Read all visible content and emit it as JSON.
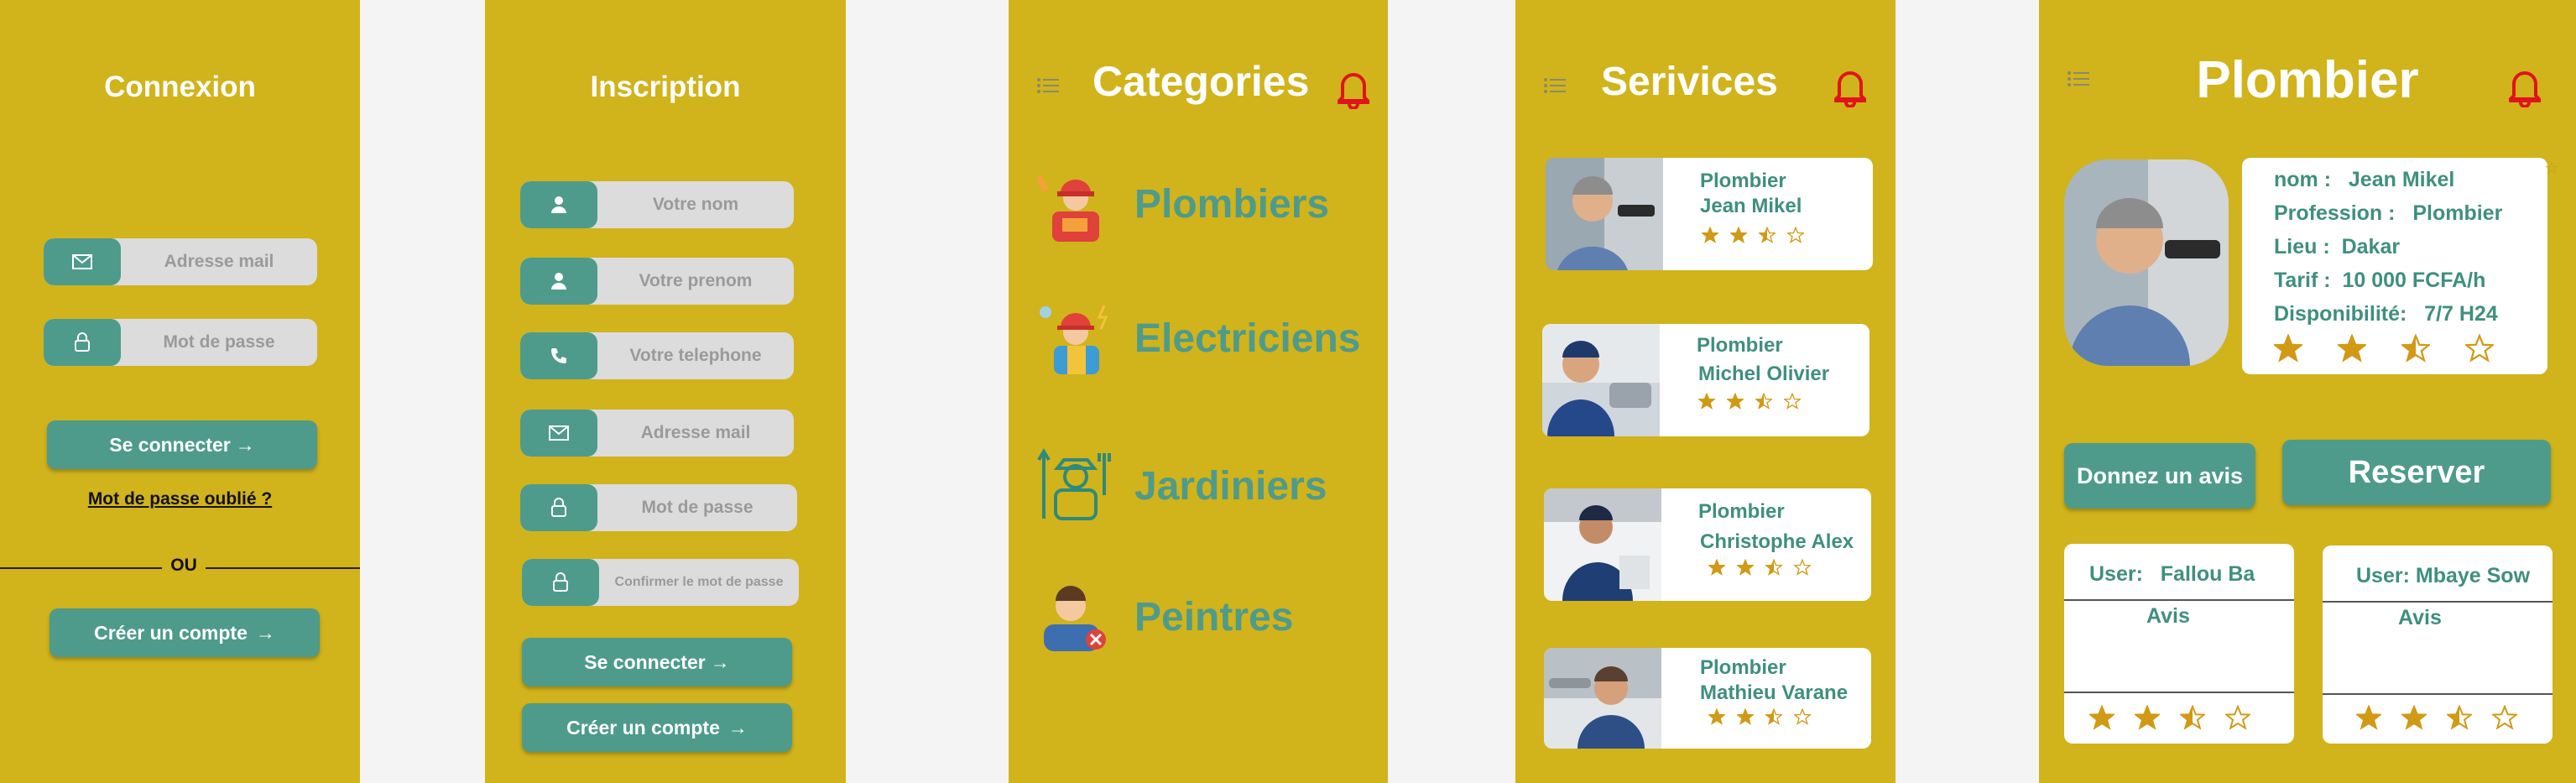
{
  "login": {
    "title": "Connexion",
    "email_placeholder": "Adresse mail",
    "password_placeholder": "Mot de passe",
    "login_button": "Se connecter",
    "forgot_password": "Mot de passe oublié ?",
    "or_text": "OU",
    "create_account": "Créer un compte"
  },
  "signup": {
    "title": "Inscription",
    "name_placeholder": "Votre nom",
    "firstname_placeholder": "Votre prenom",
    "phone_placeholder": "Votre telephone",
    "email_placeholder": "Adresse mail",
    "password_placeholder": "Mot de passe",
    "confirm_placeholder": "Confirmer le mot de passe",
    "login_button": "Se connecter",
    "create_account": "Créer un compte"
  },
  "categories": {
    "title": "Categories",
    "items": [
      {
        "label": "Plombiers",
        "icon": "plumber-icon"
      },
      {
        "label": "Electriciens",
        "icon": "electrician-icon"
      },
      {
        "label": "Jardiniers",
        "icon": "gardener-icon"
      },
      {
        "label": "Peintres",
        "icon": "painter-icon"
      }
    ]
  },
  "services": {
    "title": "Serivices",
    "items": [
      {
        "role": "Plombier",
        "name": "Jean Mikel",
        "rating": 2.5
      },
      {
        "role": "Plombier",
        "name": "Michel Olivier",
        "rating": 2.5
      },
      {
        "role": "Plombier",
        "name": "Christophe Alex",
        "rating": 2.5
      },
      {
        "role": "Plombier",
        "name": "Mathieu Varane",
        "rating": 2.5
      }
    ]
  },
  "detail": {
    "title": "Plombier",
    "nom_label": "nom :",
    "nom_value": "Jean Mikel",
    "profession_label": "Profession :",
    "profession_value": "Plombier",
    "lieu_label": "Lieu :",
    "lieu_value": "Dakar",
    "tarif_label": "Tarif :",
    "tarif_value": "10 000 FCFA/h",
    "dispo_label": "Disponibilité:",
    "dispo_value": "7/7 H24",
    "rating": 2.5,
    "review_button": "Donnez un avis",
    "reserve_button": "Reserver",
    "reviews": [
      {
        "user_label": "User:",
        "user": "Fallou Ba",
        "avis_label": "Avis",
        "rating": 2.5
      },
      {
        "user_label": "User:",
        "user": "Mbaye Sow",
        "avis_label": "Avis",
        "rating": 2.5
      }
    ]
  },
  "colors": {
    "panel": "#d1b31b",
    "teal": "#4e9b8b",
    "star": "#d19a16",
    "bell": "#e0141c"
  }
}
